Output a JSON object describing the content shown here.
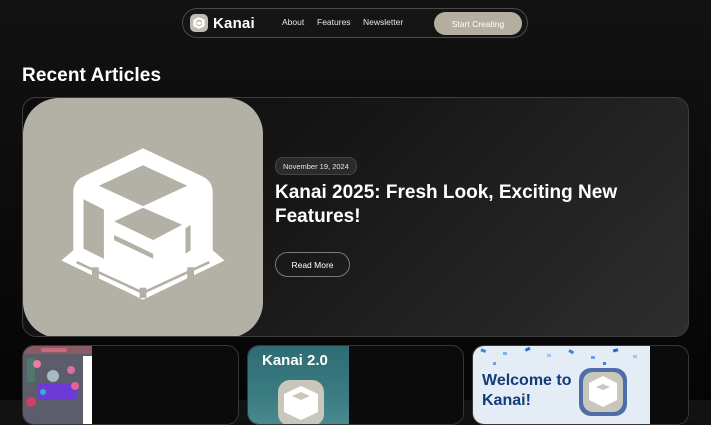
{
  "nav": {
    "brand": "Kanai",
    "links": [
      "About",
      "Features",
      "Newsletter"
    ],
    "cta": "Start Creating"
  },
  "section": {
    "title": "Recent Articles"
  },
  "featured": {
    "date": "November 19, 2024",
    "title": "Kanai 2025: Fresh Look, Exciting New Features!",
    "read_more": "Read More",
    "icon": "armchair-logo"
  },
  "cards": [
    {
      "thumb_text": ""
    },
    {
      "thumb_text": "Kanai 2.0"
    },
    {
      "thumb_text": "Welcome to Kanai!"
    }
  ],
  "colors": {
    "background": "#0e0e0e",
    "accent": "#b4ae9f",
    "logo_tile": "#b3b0a5"
  }
}
